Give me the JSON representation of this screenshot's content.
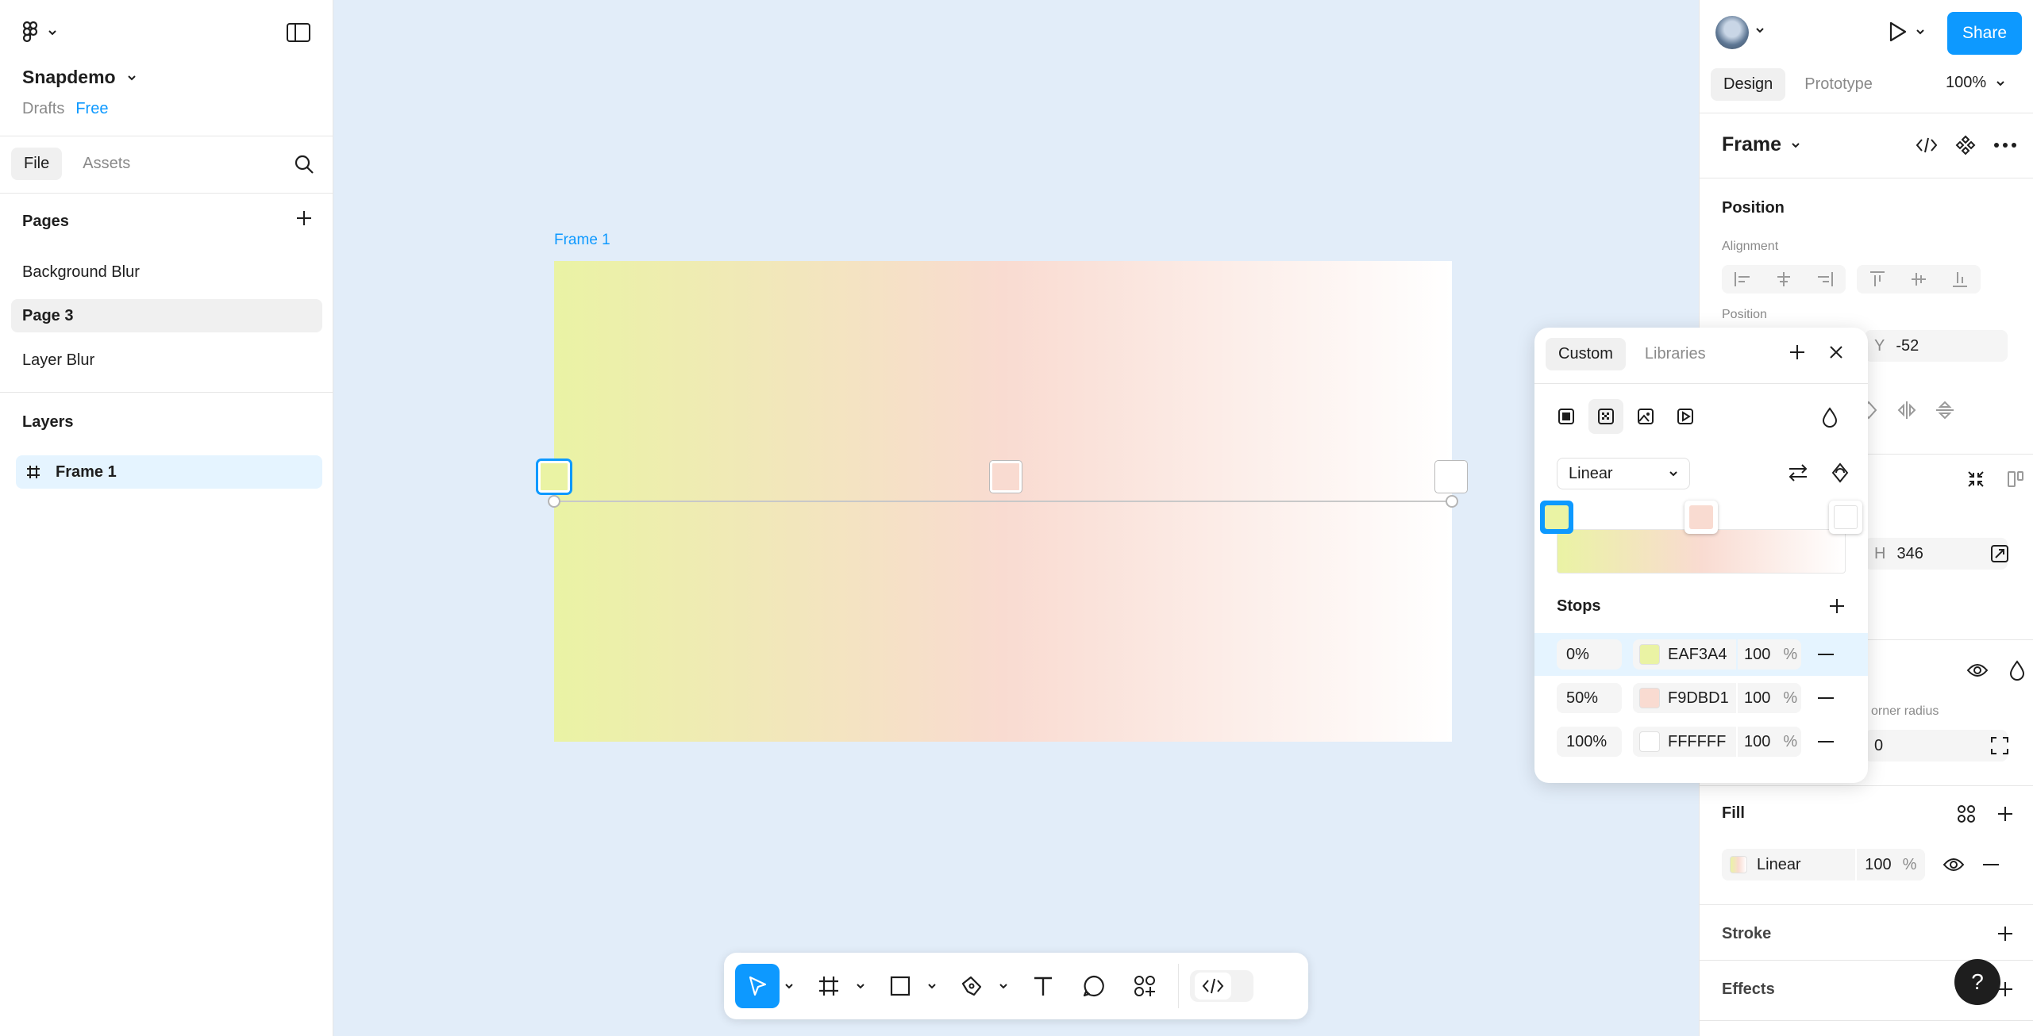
{
  "left": {
    "file_name": "Snapdemo",
    "location": "Drafts",
    "plan": "Free",
    "tabs": [
      {
        "label": "File"
      },
      {
        "label": "Assets"
      }
    ],
    "pages_title": "Pages",
    "pages": [
      {
        "label": "Background Blur"
      },
      {
        "label": "Page 3"
      },
      {
        "label": "Layer Blur"
      }
    ],
    "layers_title": "Layers",
    "layers": [
      {
        "label": "Frame 1"
      }
    ]
  },
  "canvas": {
    "frame_label": "Frame 1",
    "gradient": {
      "type": "Linear",
      "colors": [
        "#EAF3A4",
        "#F9DBD1",
        "#FFFFFF"
      ]
    }
  },
  "right": {
    "share_label": "Share",
    "tabs": [
      {
        "label": "Design"
      },
      {
        "label": "Prototype"
      }
    ],
    "zoom": "100%",
    "selection": "Frame",
    "position_title": "Position",
    "alignment_label": "Alignment",
    "position_label": "Position",
    "y_label": "Y",
    "y_value": "-52",
    "h_label": "H",
    "h_value": "346",
    "corner_label": "orner radius",
    "corner_value": "0",
    "fill_title": "Fill",
    "fill_type": "Linear",
    "fill_opacity": "100",
    "fill_unit": "%",
    "stroke_title": "Stroke",
    "effects_title": "Effects",
    "help": "?"
  },
  "picker": {
    "tabs": [
      {
        "label": "Custom"
      },
      {
        "label": "Libraries"
      }
    ],
    "gradient_type": "Linear",
    "stops_title": "Stops",
    "stops": [
      {
        "position": "0%",
        "hex": "EAF3A4",
        "color": "#EAF3A4",
        "opacity": "100",
        "unit": "%"
      },
      {
        "position": "50%",
        "hex": "F9DBD1",
        "color": "#F9DBD1",
        "opacity": "100",
        "unit": "%"
      },
      {
        "position": "100%",
        "hex": "FFFFFF",
        "color": "#FFFFFF",
        "opacity": "100",
        "unit": "%"
      }
    ]
  }
}
